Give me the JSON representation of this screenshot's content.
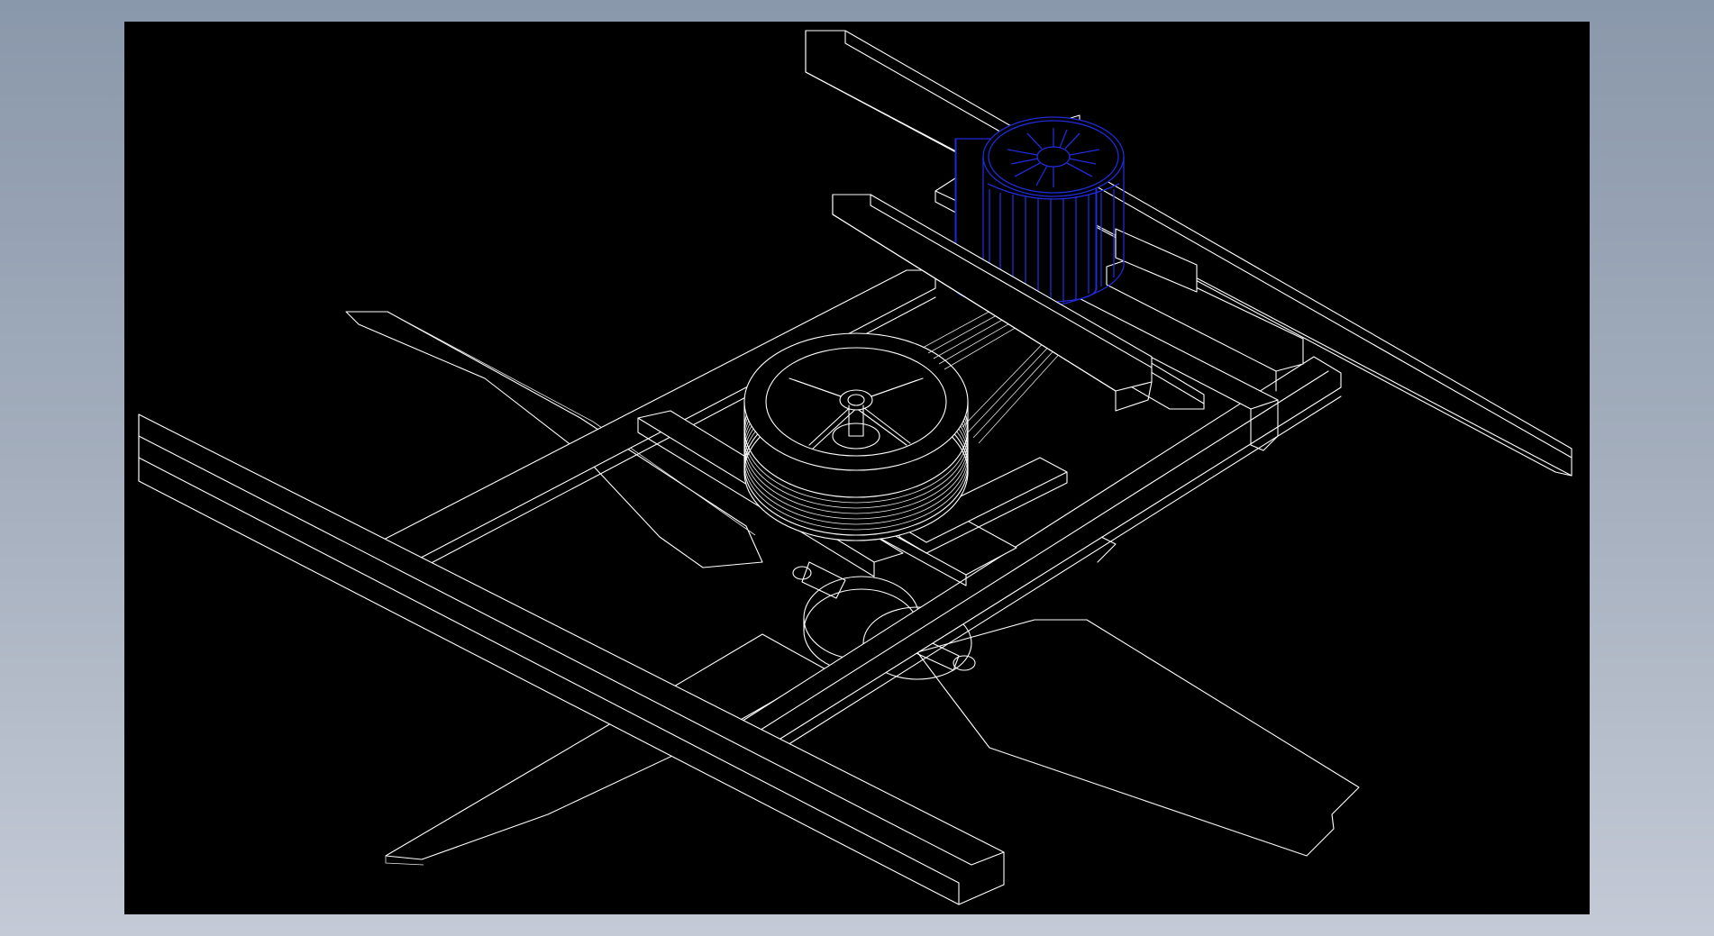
{
  "window": {
    "background_gradient": [
      "#8a98ab",
      "#c4cad6"
    ],
    "viewport_background": "#000000"
  },
  "drawing": {
    "style": "wireframe isometric CAD view",
    "line_color": "#ffffff",
    "highlight_color": "#1f2bd8",
    "components": [
      {
        "name": "support-frame",
        "color": "#ffffff"
      },
      {
        "name": "fan-blades",
        "color": "#ffffff",
        "count": 4
      },
      {
        "name": "belt-pulley",
        "color": "#ffffff"
      },
      {
        "name": "drive-belt",
        "color": "#ffffff"
      },
      {
        "name": "motor",
        "color": "#1f2bd8",
        "highlighted": true
      }
    ]
  }
}
